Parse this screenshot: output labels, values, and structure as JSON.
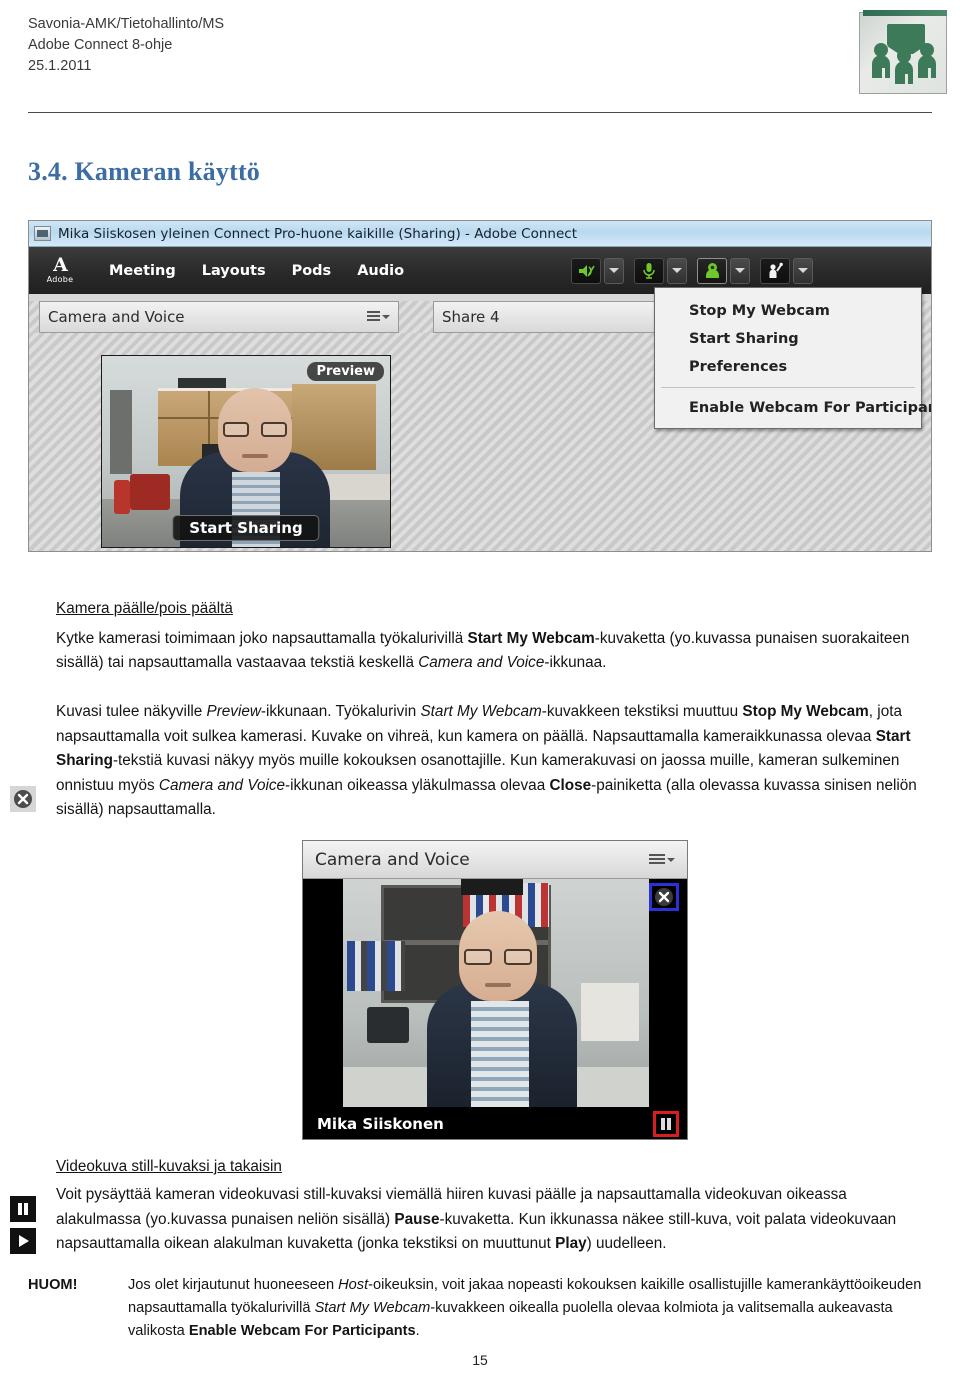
{
  "header": {
    "line1": "Savonia-AMK/Tietohallinto/MS",
    "line2": "Adobe Connect 8-ohje",
    "line3": "25.1.2011",
    "logo_icon": "meeting-people-icon",
    "logo_color": "#3d7a5a"
  },
  "section": {
    "title": "3.4. Kameran käyttö",
    "title_color": "#3c6ea5"
  },
  "screenshot1": {
    "window_title": "Mika Siiskosen yleinen Connect Pro-huone kaikille (Sharing) - Adobe Connect",
    "brand": {
      "mark": "A",
      "word": "Adobe"
    },
    "menus": [
      "Meeting",
      "Layouts",
      "Pods",
      "Audio"
    ],
    "toolbar_icons": [
      "speaker-muted-icon",
      "microphone-icon",
      "webcam-icon",
      "raise-hand-icon"
    ],
    "pods": [
      {
        "title": "Camera and Voice"
      },
      {
        "title": "Share 4"
      }
    ],
    "preview": {
      "badge": "Preview",
      "button": "Start Sharing"
    },
    "dropdown": {
      "items": [
        "Stop My Webcam",
        "Start Sharing",
        "Preferences"
      ],
      "footer_item": "Enable Webcam For Participants"
    }
  },
  "screenshot2": {
    "pod_title": "Camera and Voice",
    "user_name": "Mika Siiskonen",
    "close_icon": "close-icon",
    "close_highlight_color": "#2a31d6",
    "pause_icon": "pause-icon",
    "pause_highlight_color": "#d81e1e",
    "menu_icon": "pod-menu-icon"
  },
  "margin_icons": [
    {
      "name": "close-icon",
      "glyph": "✖"
    },
    {
      "name": "pause-icon",
      "glyph": "❙❙"
    },
    {
      "name": "play-icon",
      "glyph": "▶"
    }
  ],
  "content": {
    "subhead1": "Kamera päälle/pois päältä",
    "para1_a": "Kytke kamerasi toimimaan joko napsauttamalla työkalurivillä ",
    "para1_b": "Start My Webcam",
    "para1_c": "-kuvaketta (yo.kuvassa punaisen suorakaiteen sisällä) tai napsauttamalla vastaavaa tekstiä keskellä ",
    "para1_d": "Camera and Voice",
    "para1_e": "-ikkunaa.",
    "para2_a": "Kuvasi tulee näkyville ",
    "para2_b": "Preview",
    "para2_c": "-ikkunaan. Työkalurivin ",
    "para2_d": "Start My Webcam",
    "para2_e": "-kuvakkeen tekstiksi muuttuu ",
    "para2_f": "Stop My Webcam",
    "para2_g": ", jota napsauttamalla voit sulkea kamerasi. Kuvake on vihreä, kun kamera on päällä. Napsauttamalla kameraikkunassa olevaa ",
    "para2_h": "Start Sharing",
    "para2_i": "-tekstiä kuvasi näkyy myös muille kokouksen osanottajille. Kun kamerakuvasi on jaossa muille, kameran sulkeminen onnistuu myös ",
    "para2_j": "Camera and Voice",
    "para2_k": "-ikkunan oikeassa yläkulmassa olevaa ",
    "para2_l": "Close",
    "para2_m": "-painiketta (alla olevassa kuvassa sinisen neliön sisällä) napsauttamalla.",
    "subhead2": "Videokuva still-kuvaksi ja takaisin",
    "para3_a": "Voit pysäyttää kameran videokuvasi still-kuvaksi viemällä hiiren kuvasi päälle ja napsauttamalla videokuvan oikeassa alakulmassa (yo.kuvassa punaisen neliön sisällä) ",
    "para3_b": "Pause",
    "para3_c": "-kuvaketta. Kun ikkunassa näkee still-kuva, voit palata videokuvaan napsauttamalla oikean alakulman kuvaketta (jonka tekstiksi on muuttunut ",
    "para3_d": "Play",
    "para3_e": ") uudelleen.",
    "note_label": "HUOM!",
    "note_a": "Jos olet kirjautunut huoneeseen ",
    "note_b": "Host",
    "note_c": "-oikeuksin, voit jakaa nopeasti kokouksen kaikille osallistujille kamerankäyttöoikeuden napsauttamalla työkalurivillä ",
    "note_d": "Start My Webcam",
    "note_e": "-kuvakkeen oikealla puolella olevaa kolmiota ja valitsemalla aukeavasta valikosta ",
    "note_f": "Enable Webcam For Participants",
    "note_g": "."
  },
  "page_number": "15"
}
